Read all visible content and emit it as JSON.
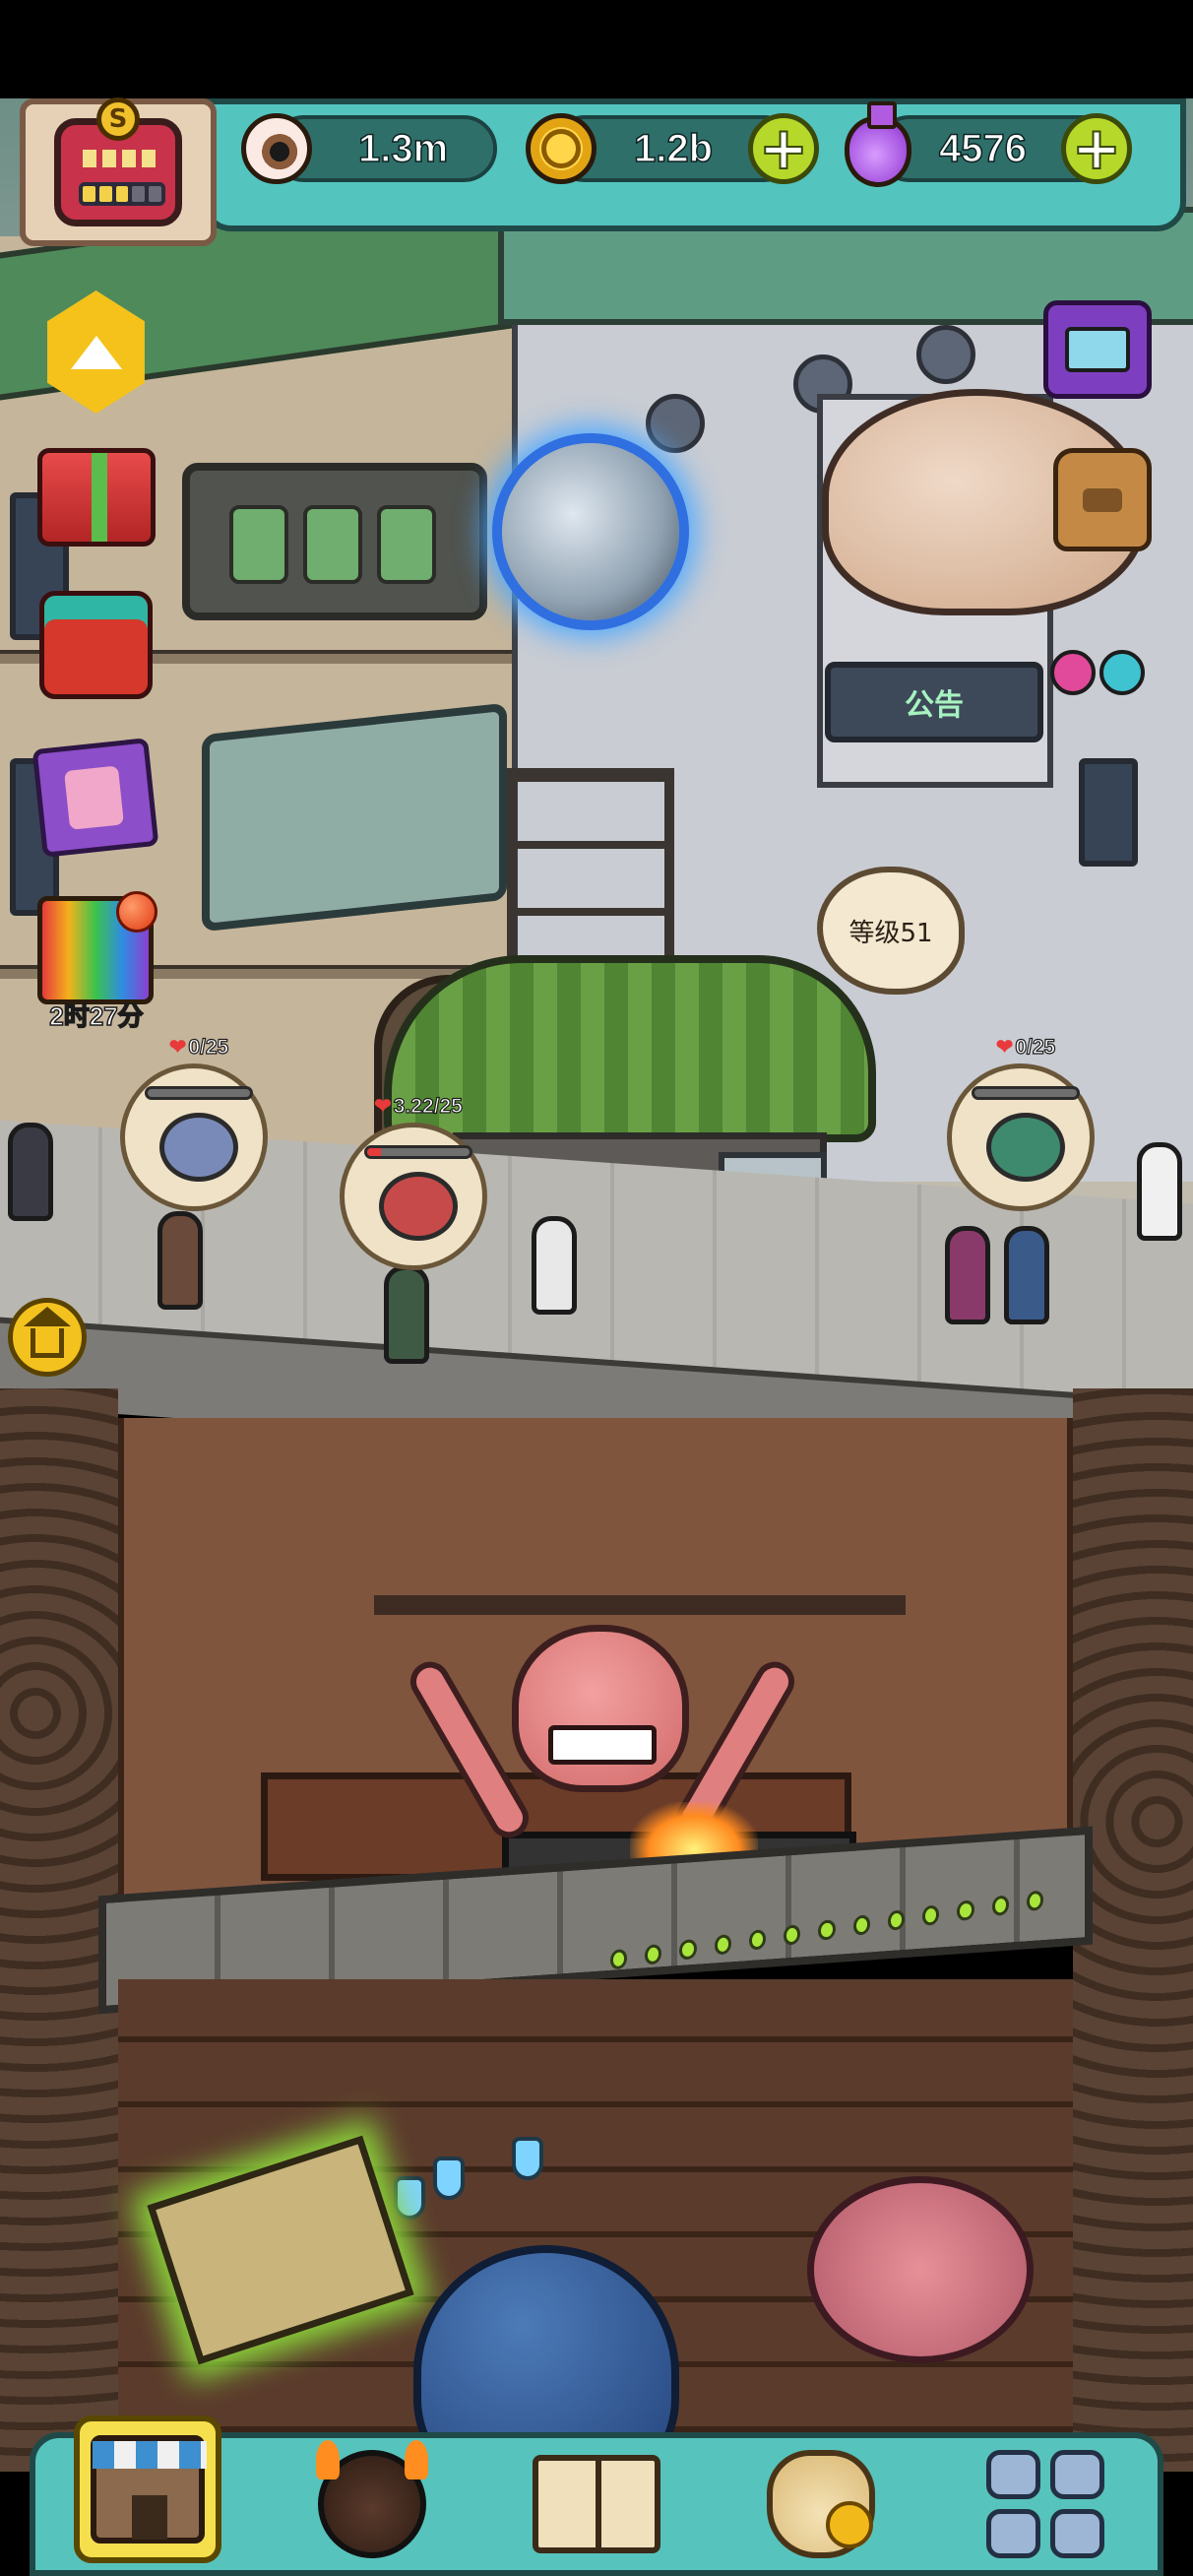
{
  "hud": {
    "eyeballs": "1.3m",
    "coins": "1.2b",
    "potions": "4576",
    "avatar_badge": "S"
  },
  "side_menu": {
    "timer": "2时27分"
  },
  "scene": {
    "announcement_sign": "公告",
    "level_bubble": "等级51",
    "orders": [
      {
        "progress": "0/25",
        "fraction": 0.0
      },
      {
        "progress": "3.22/25",
        "fraction": 0.13
      },
      {
        "progress": "0/25",
        "fraction": 0.0
      }
    ]
  },
  "bottom_nav": {
    "items": [
      "shop",
      "monster",
      "book",
      "sack",
      "grid"
    ],
    "active": "shop"
  },
  "colors": {
    "hud_teal": "#54c4bf",
    "plus_green": "#b6d82a",
    "active_tab": "#f6df4d",
    "heart_red": "#e83a3a"
  }
}
